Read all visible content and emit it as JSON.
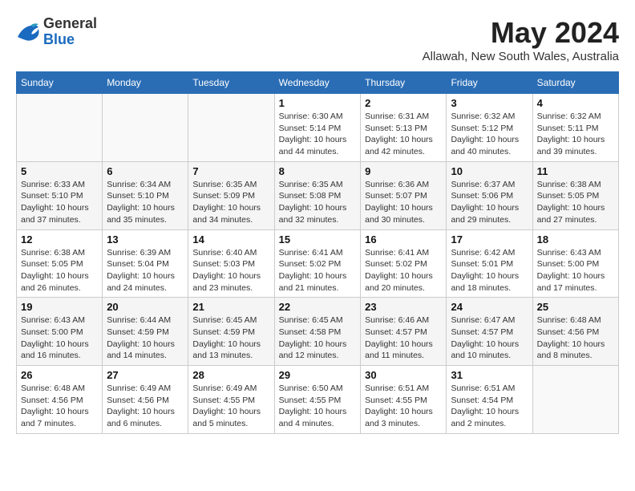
{
  "header": {
    "logo_general": "General",
    "logo_blue": "Blue",
    "month_title": "May 2024",
    "location": "Allawah, New South Wales, Australia"
  },
  "weekdays": [
    "Sunday",
    "Monday",
    "Tuesday",
    "Wednesday",
    "Thursday",
    "Friday",
    "Saturday"
  ],
  "weeks": [
    [
      {
        "day": "",
        "info": ""
      },
      {
        "day": "",
        "info": ""
      },
      {
        "day": "",
        "info": ""
      },
      {
        "day": "1",
        "info": "Sunrise: 6:30 AM\nSunset: 5:14 PM\nDaylight: 10 hours\nand 44 minutes."
      },
      {
        "day": "2",
        "info": "Sunrise: 6:31 AM\nSunset: 5:13 PM\nDaylight: 10 hours\nand 42 minutes."
      },
      {
        "day": "3",
        "info": "Sunrise: 6:32 AM\nSunset: 5:12 PM\nDaylight: 10 hours\nand 40 minutes."
      },
      {
        "day": "4",
        "info": "Sunrise: 6:32 AM\nSunset: 5:11 PM\nDaylight: 10 hours\nand 39 minutes."
      }
    ],
    [
      {
        "day": "5",
        "info": "Sunrise: 6:33 AM\nSunset: 5:10 PM\nDaylight: 10 hours\nand 37 minutes."
      },
      {
        "day": "6",
        "info": "Sunrise: 6:34 AM\nSunset: 5:10 PM\nDaylight: 10 hours\nand 35 minutes."
      },
      {
        "day": "7",
        "info": "Sunrise: 6:35 AM\nSunset: 5:09 PM\nDaylight: 10 hours\nand 34 minutes."
      },
      {
        "day": "8",
        "info": "Sunrise: 6:35 AM\nSunset: 5:08 PM\nDaylight: 10 hours\nand 32 minutes."
      },
      {
        "day": "9",
        "info": "Sunrise: 6:36 AM\nSunset: 5:07 PM\nDaylight: 10 hours\nand 30 minutes."
      },
      {
        "day": "10",
        "info": "Sunrise: 6:37 AM\nSunset: 5:06 PM\nDaylight: 10 hours\nand 29 minutes."
      },
      {
        "day": "11",
        "info": "Sunrise: 6:38 AM\nSunset: 5:05 PM\nDaylight: 10 hours\nand 27 minutes."
      }
    ],
    [
      {
        "day": "12",
        "info": "Sunrise: 6:38 AM\nSunset: 5:05 PM\nDaylight: 10 hours\nand 26 minutes."
      },
      {
        "day": "13",
        "info": "Sunrise: 6:39 AM\nSunset: 5:04 PM\nDaylight: 10 hours\nand 24 minutes."
      },
      {
        "day": "14",
        "info": "Sunrise: 6:40 AM\nSunset: 5:03 PM\nDaylight: 10 hours\nand 23 minutes."
      },
      {
        "day": "15",
        "info": "Sunrise: 6:41 AM\nSunset: 5:02 PM\nDaylight: 10 hours\nand 21 minutes."
      },
      {
        "day": "16",
        "info": "Sunrise: 6:41 AM\nSunset: 5:02 PM\nDaylight: 10 hours\nand 20 minutes."
      },
      {
        "day": "17",
        "info": "Sunrise: 6:42 AM\nSunset: 5:01 PM\nDaylight: 10 hours\nand 18 minutes."
      },
      {
        "day": "18",
        "info": "Sunrise: 6:43 AM\nSunset: 5:00 PM\nDaylight: 10 hours\nand 17 minutes."
      }
    ],
    [
      {
        "day": "19",
        "info": "Sunrise: 6:43 AM\nSunset: 5:00 PM\nDaylight: 10 hours\nand 16 minutes."
      },
      {
        "day": "20",
        "info": "Sunrise: 6:44 AM\nSunset: 4:59 PM\nDaylight: 10 hours\nand 14 minutes."
      },
      {
        "day": "21",
        "info": "Sunrise: 6:45 AM\nSunset: 4:59 PM\nDaylight: 10 hours\nand 13 minutes."
      },
      {
        "day": "22",
        "info": "Sunrise: 6:45 AM\nSunset: 4:58 PM\nDaylight: 10 hours\nand 12 minutes."
      },
      {
        "day": "23",
        "info": "Sunrise: 6:46 AM\nSunset: 4:57 PM\nDaylight: 10 hours\nand 11 minutes."
      },
      {
        "day": "24",
        "info": "Sunrise: 6:47 AM\nSunset: 4:57 PM\nDaylight: 10 hours\nand 10 minutes."
      },
      {
        "day": "25",
        "info": "Sunrise: 6:48 AM\nSunset: 4:56 PM\nDaylight: 10 hours\nand 8 minutes."
      }
    ],
    [
      {
        "day": "26",
        "info": "Sunrise: 6:48 AM\nSunset: 4:56 PM\nDaylight: 10 hours\nand 7 minutes."
      },
      {
        "day": "27",
        "info": "Sunrise: 6:49 AM\nSunset: 4:56 PM\nDaylight: 10 hours\nand 6 minutes."
      },
      {
        "day": "28",
        "info": "Sunrise: 6:49 AM\nSunset: 4:55 PM\nDaylight: 10 hours\nand 5 minutes."
      },
      {
        "day": "29",
        "info": "Sunrise: 6:50 AM\nSunset: 4:55 PM\nDaylight: 10 hours\nand 4 minutes."
      },
      {
        "day": "30",
        "info": "Sunrise: 6:51 AM\nSunset: 4:55 PM\nDaylight: 10 hours\nand 3 minutes."
      },
      {
        "day": "31",
        "info": "Sunrise: 6:51 AM\nSunset: 4:54 PM\nDaylight: 10 hours\nand 2 minutes."
      },
      {
        "day": "",
        "info": ""
      }
    ]
  ]
}
